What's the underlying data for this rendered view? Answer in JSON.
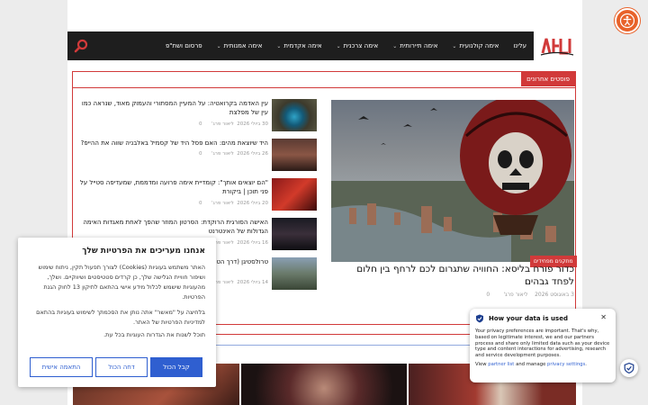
{
  "header": {
    "nav_items": [
      {
        "label": "עלינו",
        "has_menu": false
      },
      {
        "label": "אימה קולנועית",
        "has_menu": true
      },
      {
        "label": "אימה תיירותית",
        "has_menu": true
      },
      {
        "label": "אימה צרכנית",
        "has_menu": true
      },
      {
        "label": "אימה אקדמית",
        "has_menu": true
      },
      {
        "label": "אימה אמנותית",
        "has_menu": true
      },
      {
        "label": "פרסום ושת\"פ",
        "has_menu": false
      }
    ],
    "accent_color": "#d13a3a"
  },
  "section": {
    "tab_label": "פוסטים אחרונים"
  },
  "featured": {
    "category": "מתקנים מפחידים",
    "title": "כדור פורח בליסא: החוויה שתגרום לכם לרחף בין חלום לפחד גבהים",
    "author": "ליאור פרג'",
    "date": "3 באוגוסט 2026",
    "comments": "0"
  },
  "side_posts": [
    {
      "title": "עין האדמה בקרואטיה: על המעיין המסתורי והעמוק מאוד, שנראה כמו עין של מפלצת",
      "date": "30 ביולי 2026",
      "author": "ליאור פרג'",
      "comments": "0"
    },
    {
      "title": "היד שיוצאת מהים: האם פסל היד של קסמיל באלבניה שווה את ההייפ?",
      "date": "26 ביולי 2026",
      "author": "ליאור פרג'",
      "comments": "0"
    },
    {
      "title": "\"הם יוצאים אותך\": קומדיית אימה פרועה ומדממת, שמעדיפה סטייל על פני תוכן | ביקורת",
      "date": "20 ביולי 2026",
      "author": "ליאור פרג'",
      "comments": "0"
    },
    {
      "title": "האישה הסורגית הרוקדת: הסרטון המוזר שהפך לאחת מאגדות האימה הגדולות של האינטרנט",
      "date": "16 ביולי 2026",
      "author": "ליאור פרג'",
      "comments": "0"
    },
    {
      "title": "טרולסטיגן (דרך הטרולים): ... למיתולוגיה סקנדינבית",
      "date": "14 ביולי 2026",
      "author": "ליאור פרג'",
      "comments": "0"
    }
  ],
  "cookie": {
    "title": "אנחנו מעריכים את הפרטיות שלך",
    "body1": "האתר משתמש בעוגיות (Cookies) לצורך תפעול תקין, ניתוח שימוש ושיפור חוויית הגלישה שלך, כן קרדים סטטיסטים ושיווקיים. ושלך, מהעוגיות שישמש לכלול מידע אישי בהתאם לתיקון 13 לחוק הגנת הפרטיות.",
    "body2": "בלחיצה על \"מאשר\" אתה נותן את הסכמתך לשימוש בעוגיות בהתאם למדיניות הפרטיות של האתר.",
    "body3": "תוכל לשנות את הגדרות העוגיות בכל עת.",
    "btn_accept": "קבל הכול",
    "btn_reject": "דחה הכול",
    "btn_custom": "התאמה אישית",
    "btn_color": "#2f5fd0"
  },
  "privacy": {
    "title": "How your data is used",
    "text": "Your privacy preferences are important. That's why, based on legitimate interest, we and our partners process and share only limited data such as your device type and content interactions for advertising, research and service development purposes.",
    "link_prefix": "View",
    "link_partners": "partner list",
    "link_middle": "and manage",
    "link_settings": "privacy settings",
    "link_suffix": "."
  }
}
